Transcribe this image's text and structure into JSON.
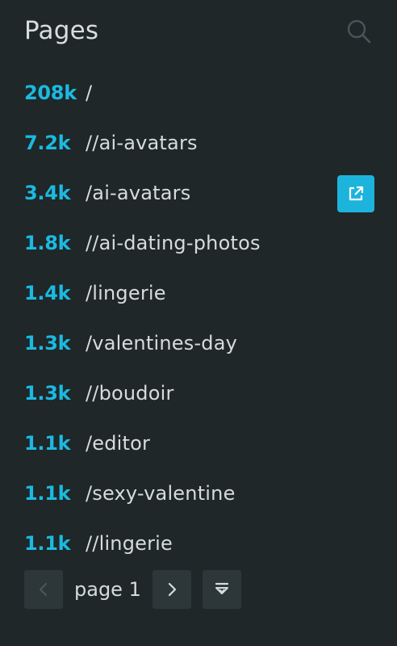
{
  "header": {
    "title": "Pages"
  },
  "rows": [
    {
      "count": "208k",
      "path": "/"
    },
    {
      "count": "7.2k",
      "path": "//ai-avatars"
    },
    {
      "count": "3.4k",
      "path": "/ai-avatars"
    },
    {
      "count": "1.8k",
      "path": "//ai-dating-photos"
    },
    {
      "count": "1.4k",
      "path": "/lingerie"
    },
    {
      "count": "1.3k",
      "path": "/valentines-day"
    },
    {
      "count": "1.3k",
      "path": "//boudoir"
    },
    {
      "count": "1.1k",
      "path": "/editor"
    },
    {
      "count": "1.1k",
      "path": "/sexy-valentine"
    },
    {
      "count": "1.1k",
      "path": "//lingerie"
    }
  ],
  "pagination": {
    "label": "page 1"
  },
  "colors": {
    "background": "#1f2729",
    "accent": "#1cb9e0",
    "text": "#d6dcdd",
    "button_bg": "#2d3638"
  },
  "icons": {
    "search": "search-icon",
    "open_link": "external-link-icon",
    "prev": "chevron-left-icon",
    "next": "chevron-right-icon",
    "export": "download-icon"
  }
}
